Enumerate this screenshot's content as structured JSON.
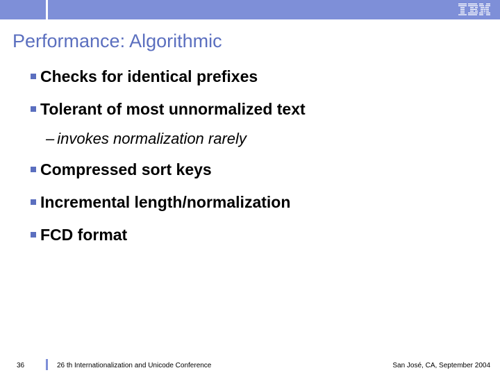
{
  "header": {
    "logo_alt": "IBM"
  },
  "title": "Performance: Algorithmic",
  "bullets": [
    {
      "text": "Checks for identical prefixes"
    },
    {
      "text": "Tolerant of most unnormalized text"
    },
    {
      "text": "Compressed sort keys"
    },
    {
      "text": "Incremental length/normalization"
    },
    {
      "text": "FCD format"
    }
  ],
  "sub_bullet": "invokes normalization rarely",
  "footer": {
    "page": "36",
    "left": "26 th Internationalization and Unicode Conference",
    "right": "San José, CA, September 2004"
  }
}
